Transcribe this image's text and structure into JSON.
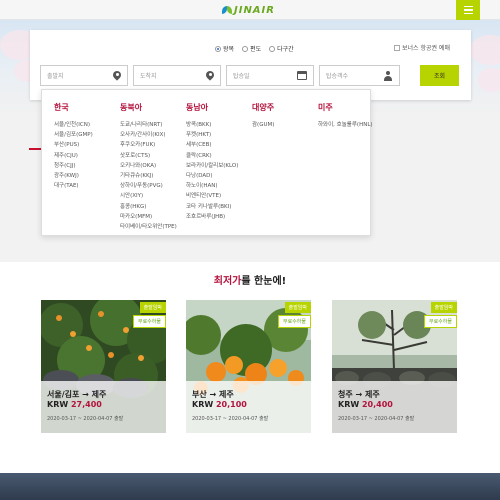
{
  "header": {
    "logo_text": "JINAIR",
    "menu_icon": "hamburger-icon"
  },
  "search": {
    "trip_types": [
      "왕복",
      "편도",
      "다구간"
    ],
    "selected_trip": "왕복",
    "bonus_label": "보너스 항공권 예매",
    "departure_placeholder": "출발지",
    "arrival_placeholder": "도착지",
    "date_placeholder": "탑승일",
    "passengers_placeholder": "탑승객수",
    "search_label": "조회"
  },
  "regions": [
    {
      "name": "한국",
      "cities": [
        "서울/인천(ICN)",
        "서울/김포(GMP)",
        "부산(PUS)",
        "제주(CJU)",
        "청주(CJJ)",
        "광주(KWJ)",
        "대구(TAE)"
      ]
    },
    {
      "name": "동북아",
      "cities": [
        "도쿄/나리타(NRT)",
        "오사카/간사이(KIX)",
        "후쿠오카(FUK)",
        "삿포로(CTS)",
        "오키나와(OKA)",
        "기타큐슈(KKJ)",
        "상하이/푸동(PVG)",
        "시안(XIY)",
        "홍콩(HKG)",
        "마카오(MFM)",
        "타이베이/타오위안(TPE)"
      ]
    },
    {
      "name": "동남아",
      "cities": [
        "방콕(BKK)",
        "푸켓(HKT)",
        "세부(CEB)",
        "클락(CRK)",
        "보라카이/칼리보(KLO)",
        "다낭(DAD)",
        "하노이(HAN)",
        "비엔티안(VTE)",
        "코타 키나발루(BKI)",
        "조호르바루(JHB)"
      ]
    },
    {
      "name": "대양주",
      "cities": [
        "괌(GUM)"
      ]
    },
    {
      "name": "미주",
      "cities": [
        "하와이, 호놀룰루(HNL)"
      ]
    }
  ],
  "deals": {
    "title_highlight": "최저가",
    "title_rest": "를 한눈에!",
    "badge_1": "출발임박",
    "badge_2": "무료수하물",
    "cards": [
      {
        "route": "서울/김포 → 제주",
        "currency": "KRW",
        "price": "27,400",
        "dates": "2020-03-17 ~ 2020-04-07 출발"
      },
      {
        "route": "부산 → 제주",
        "currency": "KRW",
        "price": "20,100",
        "dates": "2020-03-17 ~ 2020-04-07 출발"
      },
      {
        "route": "청주 → 제주",
        "currency": "KRW",
        "price": "20,400",
        "dates": "2020-03-17 ~ 2020-04-07 출발"
      }
    ]
  },
  "colors": {
    "brand_green": "#b7d400",
    "accent_red": "#b3123c"
  }
}
